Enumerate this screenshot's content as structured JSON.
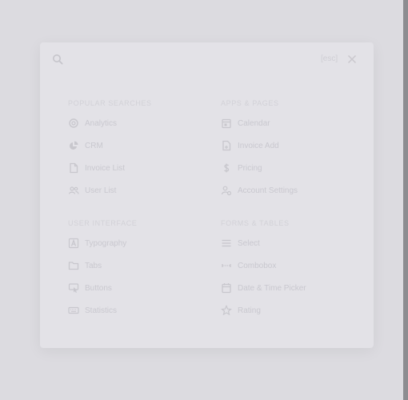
{
  "dialog": {
    "search": {
      "icon": "search-icon",
      "esc_label": "[esc]",
      "close_icon": "close-icon"
    },
    "sections": [
      {
        "title": "Popular Searches",
        "items": [
          {
            "label": "Analytics",
            "icon": "donut-chart-icon"
          },
          {
            "label": "CRM",
            "icon": "chart-pie-icon"
          },
          {
            "label": "Invoice List",
            "icon": "file-icon"
          },
          {
            "label": "User List",
            "icon": "users-icon"
          }
        ]
      },
      {
        "title": "Apps & Pages",
        "items": [
          {
            "label": "Calendar",
            "icon": "calendar-icon"
          },
          {
            "label": "Invoice Add",
            "icon": "file-plus-icon"
          },
          {
            "label": "Pricing",
            "icon": "dollar-icon"
          },
          {
            "label": "Account Settings",
            "icon": "user-settings-icon"
          }
        ]
      },
      {
        "title": "User Interface",
        "items": [
          {
            "label": "Typography",
            "icon": "letter-a-icon"
          },
          {
            "label": "Tabs",
            "icon": "folder-icon"
          },
          {
            "label": "Buttons",
            "icon": "button-cursor-icon"
          },
          {
            "label": "Statistics",
            "icon": "keyboard-icon"
          }
        ]
      },
      {
        "title": "Forms & Tables",
        "items": [
          {
            "label": "Select",
            "icon": "list-icon"
          },
          {
            "label": "Combobox",
            "icon": "combobox-icon"
          },
          {
            "label": "Date & Time Picker",
            "icon": "calendar-icon"
          },
          {
            "label": "Rating",
            "icon": "star-icon"
          }
        ]
      }
    ]
  }
}
